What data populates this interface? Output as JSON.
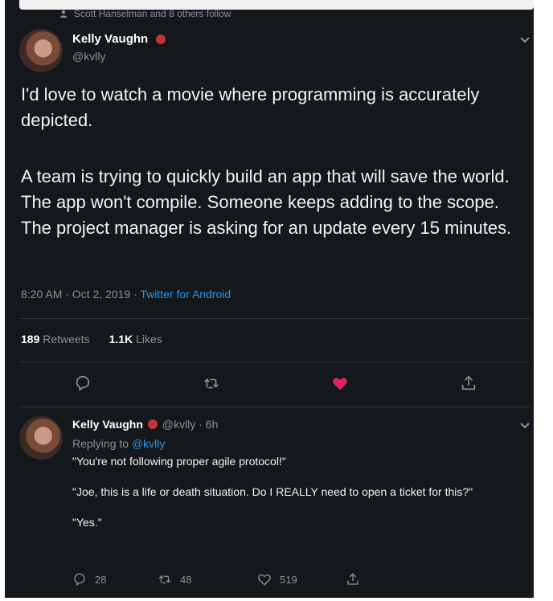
{
  "social_context": {
    "text": "Scott Hanselman and 8 others follow"
  },
  "tweet": {
    "author_name": "Kelly Vaughn",
    "author_handle": "@kvlly",
    "paragraph_1": "I'd love to watch a movie where programming is accurately depicted.",
    "paragraph_2": "A team is trying to quickly build an app that will save the world. The app won't compile. Someone keeps adding to the scope. The project manager is asking for an update every 15 minutes.",
    "timestamp": "8:20 AM · Oct 2, 2019 ·",
    "source": "Twitter for Android",
    "retweets_count": "189",
    "retweets_label": "Retweets",
    "likes_count": "1.1K",
    "likes_label": "Likes"
  },
  "reply": {
    "author_name": "Kelly Vaughn",
    "meta": "@kvlly · 6h",
    "replying_to_label": "Replying to",
    "replying_to_handle": "@kvlly",
    "lines": [
      "\"You're not following proper agile protocol!\"",
      "\"Joe, this is a life or death situation. Do I REALLY need to open a ticket for this?\"",
      "\"Yes.\""
    ],
    "reply_count": "28",
    "retweet_count": "48",
    "like_count": "519"
  },
  "colors": {
    "background": "#14171c",
    "text_primary": "#f3f3f3",
    "text_secondary": "#8a9099",
    "link": "#2b93e6",
    "like_active": "#e0245e",
    "badge": "#c0343b"
  },
  "icons": {
    "social": "person-icon",
    "menu": "chevron-down-icon",
    "reply": "reply-icon",
    "retweet": "retweet-icon",
    "like": "heart-icon",
    "share": "share-icon"
  }
}
